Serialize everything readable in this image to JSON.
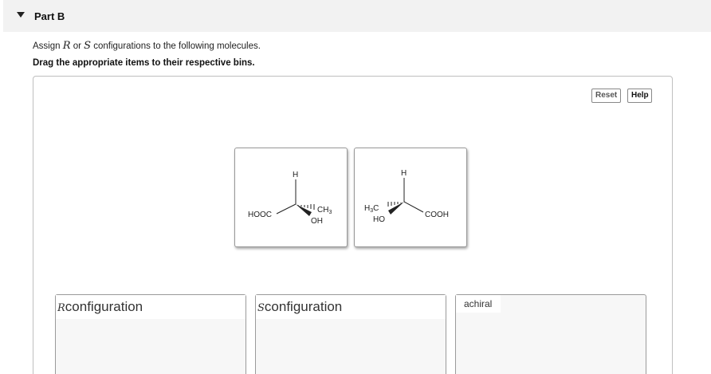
{
  "part": {
    "title": "Part B"
  },
  "instructions": {
    "line1_prefix": "Assign ",
    "r_symbol": "R",
    "or_word": " or ",
    "s_symbol": "S",
    "line1_suffix": " configurations to the following molecules.",
    "line2": "Drag the appropriate items to their respective bins."
  },
  "toolbar": {
    "reset_label": "Reset",
    "help_label": "Help"
  },
  "molecules": [
    {
      "top": "H",
      "left": "HOOC",
      "right": "CH3",
      "wedge": "OH"
    },
    {
      "top": "H",
      "left": "H3C",
      "wedge": "HO",
      "right": "COOH"
    }
  ],
  "bins": [
    {
      "symbol": "R",
      "label": "configuration"
    },
    {
      "symbol": "S",
      "label": "configuration"
    },
    {
      "symbol": "",
      "label": "achiral"
    }
  ]
}
